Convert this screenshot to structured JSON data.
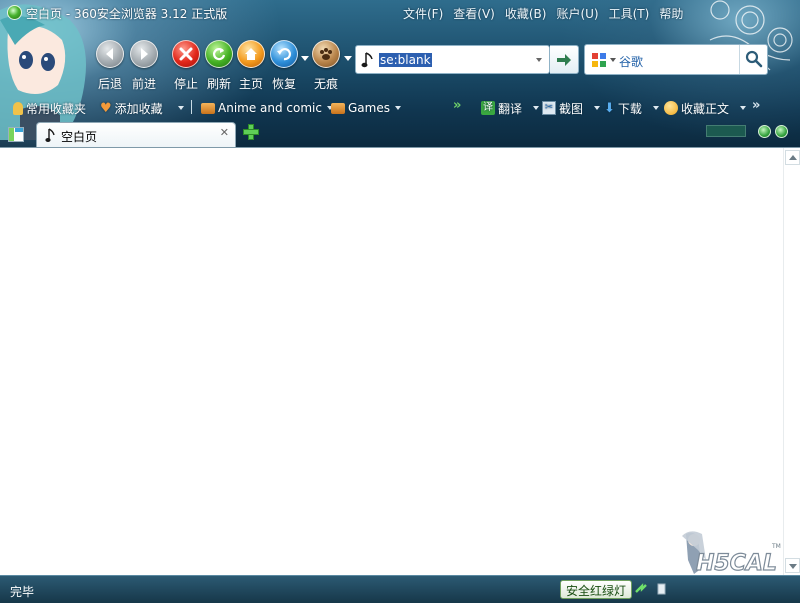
{
  "window": {
    "title": "空白页 - 360安全浏览器 3.12 正式版"
  },
  "menu": [
    "文件(F)",
    "查看(V)",
    "收藏(B)",
    "账户(U)",
    "工具(T)",
    "帮助"
  ],
  "nav": {
    "back": "后退",
    "forward": "前进",
    "stop": "停止",
    "refresh": "刷新",
    "home": "主页",
    "restore": "恢复",
    "private": "无痕"
  },
  "address": {
    "value": "se:blank"
  },
  "search": {
    "engine": "谷歌"
  },
  "toolbar": {
    "favorites": "常用收藏夹",
    "add_to_favorites": "添加收藏",
    "bookmark_anime": "Anime and comic",
    "bookmark_games": "Games",
    "translate": "翻译",
    "screenshot": "截图",
    "download": "下载",
    "save_text": "收藏正文"
  },
  "tab": {
    "title": "空白页"
  },
  "status": {
    "text": "完毕",
    "safety_light": "安全红绿灯"
  },
  "colors": {
    "skin_dark": "#103650",
    "skin_light": "#2f6d8d",
    "highlight": "#2c5fb0"
  }
}
